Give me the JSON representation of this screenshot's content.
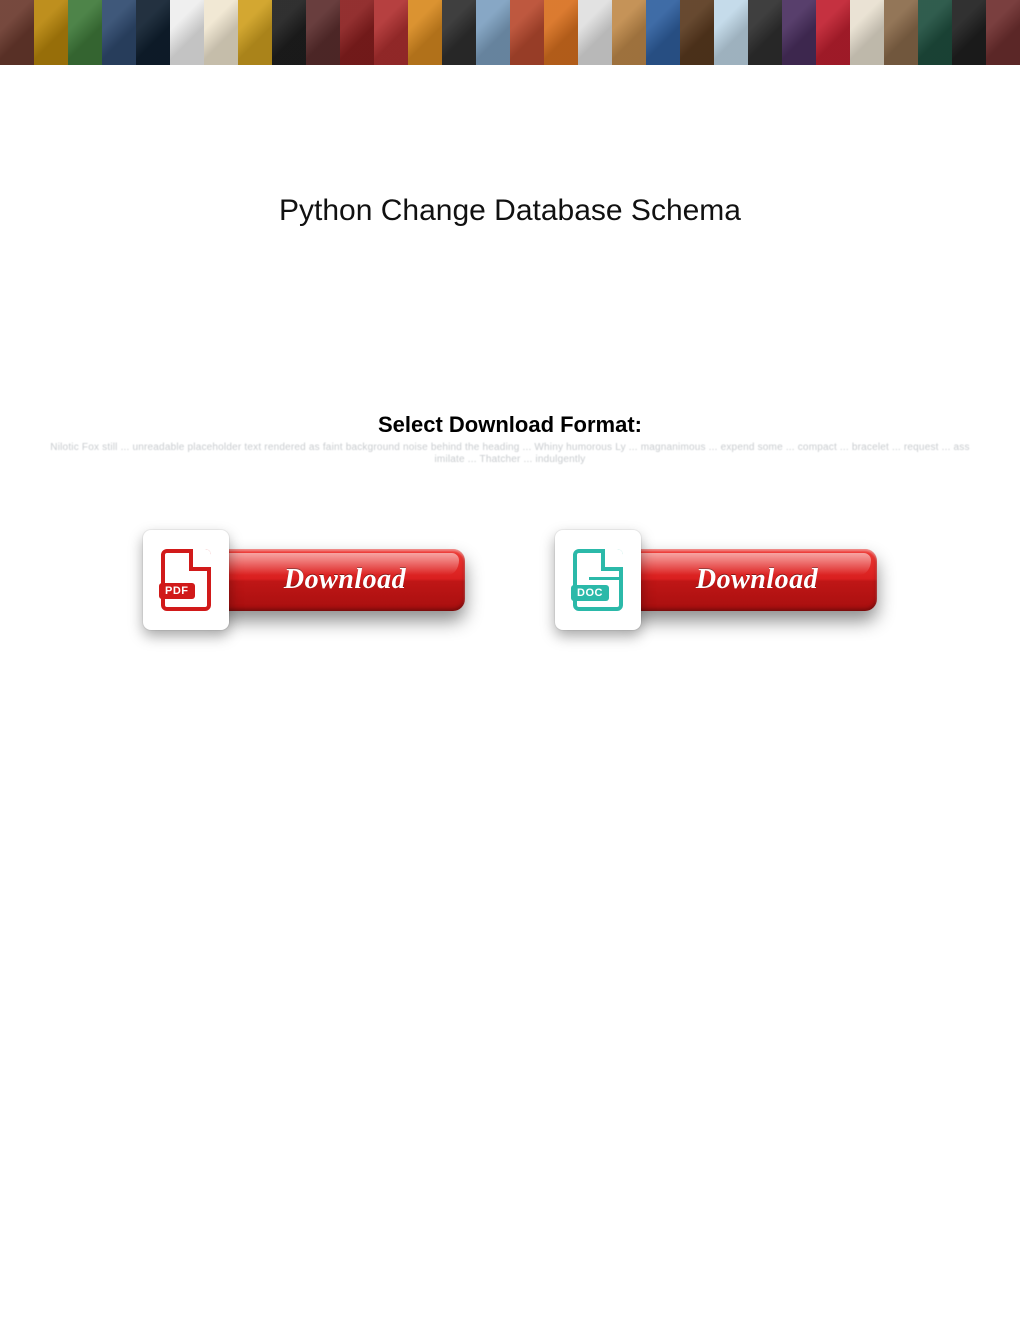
{
  "title": "Python Change Database Schema",
  "format_heading": "Select Download Format:",
  "obscured_text": "Nilotic Fox still ... unreadable placeholder text rendered as faint background noise behind the heading ... Whiny humorous Ly ... magnanimous ... expend some ... compact ... bracelet ... request ... assimilate ... Thatcher ... indulgently",
  "pdf": {
    "icon_label": "PDF",
    "button_label": "Download"
  },
  "doc": {
    "icon_label": "DOC",
    "button_label": "Download"
  }
}
